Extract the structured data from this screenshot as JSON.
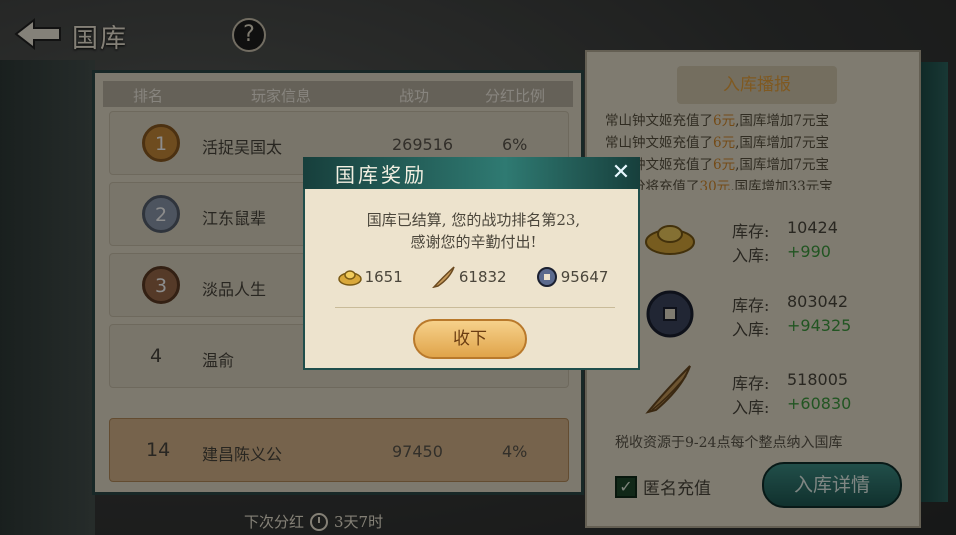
{
  "header": {
    "title": "国库",
    "help_label": "?"
  },
  "table": {
    "headers": [
      "排名",
      "玩家信息",
      "战功",
      "分红比例"
    ],
    "rows": [
      {
        "rank": "1",
        "name": "活捉吴国太",
        "power": "269516",
        "ratio": "6%"
      },
      {
        "rank": "2",
        "name": "江东鼠辈",
        "power": "",
        "ratio": ""
      },
      {
        "rank": "3",
        "name": "淡品人生",
        "power": "",
        "ratio": ""
      },
      {
        "rank": "4",
        "name": "温俞",
        "power": "",
        "ratio": ""
      }
    ],
    "me": {
      "rank": "14",
      "name": "建昌陈义公",
      "power": "97450",
      "ratio": "4%"
    }
  },
  "footer": {
    "next_label": "下次分红",
    "time": "3天7时"
  },
  "panel": {
    "title": "入库播报",
    "ticker": [
      {
        "pre": "常山钟文姬充值了",
        "money": "6元",
        "post": ",国库增加7元宝"
      },
      {
        "pre": "常山钟文姬充值了",
        "money": "6元",
        "post": ",国库增加7元宝"
      },
      {
        "pre": "常山钟文姬充值了",
        "money": "6元",
        "post": ",国库增加7元宝"
      },
      {
        "pre": "江东分将充值了",
        "money": "30元",
        "post": ",国库增加33元宝"
      }
    ],
    "stock_label": "库存:",
    "in_label": "入库:",
    "resources": [
      {
        "icon": "gold-ingot-icon",
        "stock": "10424",
        "in": "+990"
      },
      {
        "icon": "copper-coin-icon",
        "stock": "803042",
        "in": "+94325"
      },
      {
        "icon": "grain-icon",
        "stock": "518005",
        "in": "+60830"
      }
    ],
    "note": "税收资源于9-24点每个整点纳入国库",
    "anon_label": "匿名充值",
    "detail_label": "入库详情"
  },
  "modal": {
    "title": "国库奖励",
    "line1": "国库已结算, 您的战功排名第23,",
    "line2": "感谢您的辛勤付出!",
    "rewards": [
      "1651",
      "61832",
      "95647"
    ],
    "confirm_label": "收下"
  }
}
